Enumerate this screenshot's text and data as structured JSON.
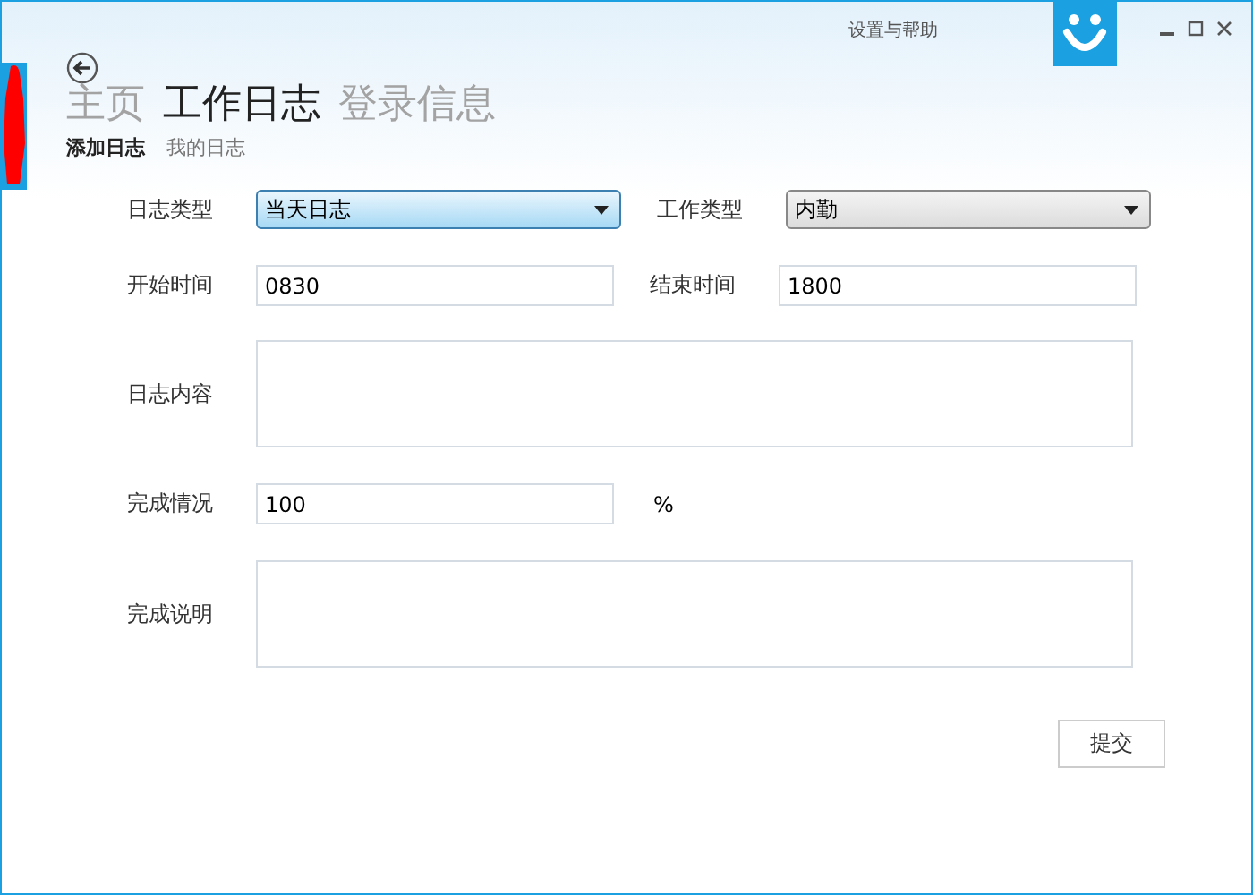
{
  "title_bar": {
    "settings_link": "设置与帮助"
  },
  "nav_tabs": [
    {
      "label": "主页",
      "selected": false
    },
    {
      "label": "工作日志",
      "selected": true
    },
    {
      "label": "登录信息",
      "selected": false
    }
  ],
  "sub_tabs": [
    {
      "label": "添加日志",
      "selected": true
    },
    {
      "label": "我的日志",
      "selected": false
    }
  ],
  "form": {
    "log_type": {
      "label": "日志类型",
      "value": "当天日志",
      "focused": true
    },
    "work_type": {
      "label": "工作类型",
      "value": "内勤",
      "focused": false
    },
    "start_time": {
      "label": "开始时间",
      "value": "0830"
    },
    "end_time": {
      "label": "结束时间",
      "value": "1800"
    },
    "content": {
      "label": "日志内容"
    },
    "completion": {
      "label": "完成情况",
      "value": "100",
      "unit": "%"
    },
    "notes": {
      "label": "完成说明"
    }
  },
  "submit_button": "提交"
}
